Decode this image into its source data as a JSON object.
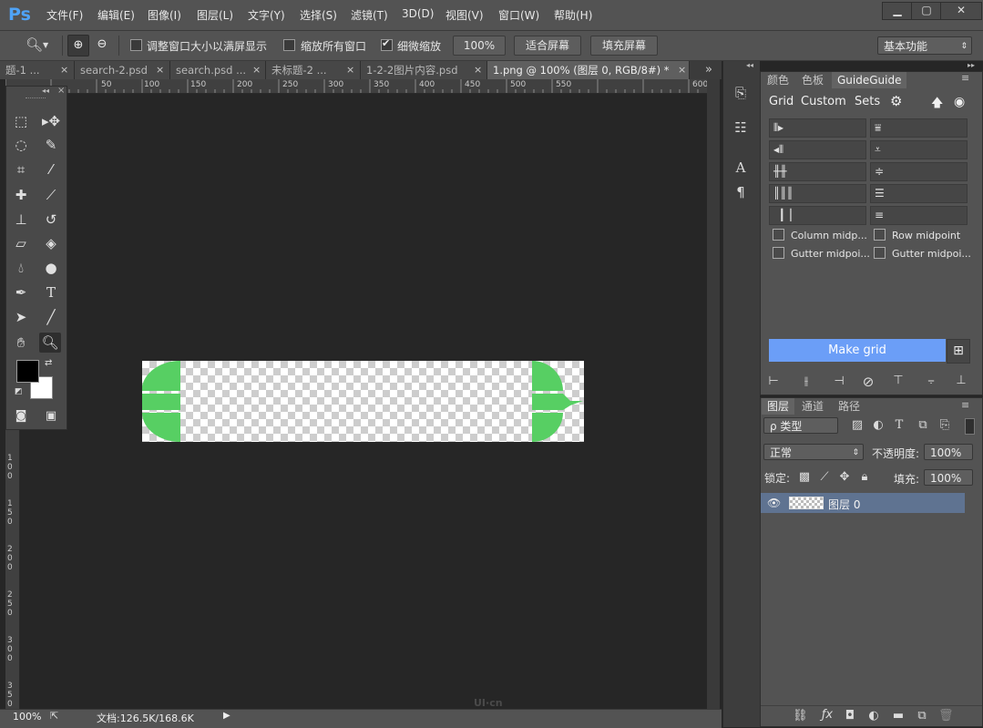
{
  "app": {
    "logo": "Ps"
  },
  "menu": [
    "文件(F)",
    "编辑(E)",
    "图像(I)",
    "图层(L)",
    "文字(Y)",
    "选择(S)",
    "滤镜(T)",
    "3D(D)",
    "视图(V)",
    "窗口(W)",
    "帮助(H)"
  ],
  "window_controls": {
    "minimize": "▁",
    "maximize": "▢",
    "close": "✕"
  },
  "options": {
    "resize_windows_label": "调整窗口大小以满屏显示",
    "zoom_all_label": "缩放所有窗口",
    "scrubby_zoom_label": "细微缩放",
    "zoom_100": "100%",
    "fit_screen": "适合屏幕",
    "fill_screen": "填充屏幕",
    "workspace": "基本功能"
  },
  "tabs": [
    {
      "label": "题-1 ...",
      "close": "×"
    },
    {
      "label": "search-2.psd",
      "close": "×"
    },
    {
      "label": "search.psd ...",
      "close": "×"
    },
    {
      "label": "未标题-2 ...",
      "close": "×"
    },
    {
      "label": "1-2-2图片内容.psd",
      "close": "×"
    },
    {
      "label": "1.png @ 100% (图层 0, RGB/8#) *",
      "close": "×"
    }
  ],
  "tab_overflow": "»",
  "ruler": {
    "h_labels": [
      "50",
      "100",
      "150",
      "200",
      "250",
      "300",
      "350",
      "400",
      "450",
      "500",
      "550",
      "600"
    ],
    "v_labels": [
      "1\n0\n0",
      "1\n5\n0",
      "2\n0\n0",
      "2\n5\n0",
      "3\n0\n0",
      "3\n5\n0"
    ]
  },
  "status": {
    "zoom": "100%",
    "doc": "文档:126.5K/168.6K",
    "arrow": "▶"
  },
  "watermark": "UI·cn",
  "guideguide": {
    "tabs": [
      "颜色",
      "色板",
      "GuideGuide"
    ],
    "subtabs": [
      "Grid",
      "Custom",
      "Sets"
    ],
    "column_midpoint": "Column midp...",
    "row_midpoint": "Row midpoint",
    "gutter_midpoint_col": "Gutter midpoi...",
    "gutter_midpoint_row": "Gutter midpoi...",
    "make_grid": "Make grid"
  },
  "layers": {
    "tabs": [
      "图层",
      "通道",
      "路径"
    ],
    "filter_kind": "ρ 类型",
    "blend_mode": "正常",
    "opacity_label": "不透明度:",
    "opacity": "100%",
    "lock_label": "锁定:",
    "fill_label": "填充:",
    "fill": "100%",
    "items": [
      {
        "name": "图层 0",
        "visible": true
      }
    ]
  },
  "colors": {
    "accent_blue": "#6b9ef7",
    "shape_green": "#57cf63",
    "foreground": "#000000",
    "background": "#ffffff"
  }
}
